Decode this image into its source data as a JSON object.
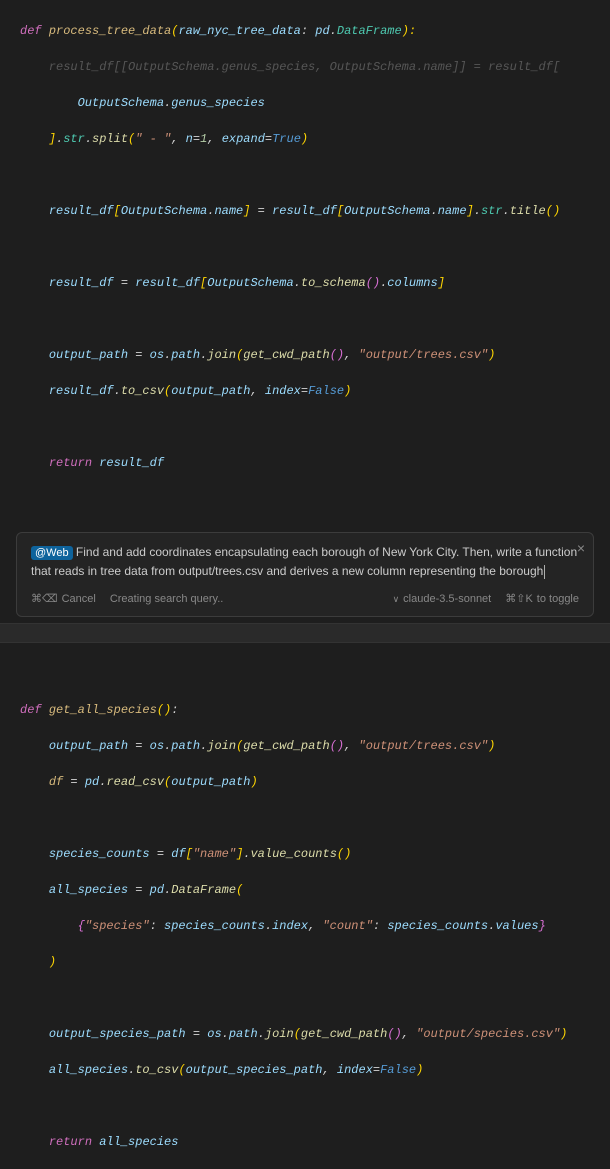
{
  "code1": {
    "def": "def",
    "fn": "process_tree_data",
    "sig_open": "(",
    "param": "raw_nyc_tree_data",
    "colon_sp": ": ",
    "mod": "pd",
    "dot": ".",
    "dftype": "DataFrame",
    "sig_close": "):",
    "faded_line": "    result_df[[OutputSchema.genus_species, OutputSchema.name]] = result_df[",
    "l2a": "        OutputSchema",
    "l2b": "genus_species",
    "l3a": "    ",
    "l3_str": "str",
    "l3_split": "split",
    "l3_sep": "\" - \"",
    "l3_n": "n",
    "l3_nval": "1",
    "l3_expand": "expand",
    "l3_true": "True",
    "l5_rd": "result_df",
    "l5_os": "OutputSchema",
    "l5_name": "name",
    "l5_str": "str",
    "l5_title": "title",
    "l7_rd": "result_df",
    "l7_os": "OutputSchema",
    "l7_ts": "to_schema",
    "l7_cols": "columns",
    "l9_op": "output_path",
    "l9_os": "os",
    "l9_path": "path",
    "l9_join": "join",
    "l9_gcp": "get_cwd_path",
    "l9_str": "\"output/trees.csv\"",
    "l10_rd": "result_df",
    "l10_tc": "to_csv",
    "l10_op": "output_path",
    "l10_idx": "index",
    "l10_false": "False",
    "ret": "return",
    "retv": "result_df"
  },
  "prompt": {
    "mention": "@Web",
    "text": "  Find and add coordinates encapsulating each borough of New York City. Then, write a function that reads in tree data from output/trees.csv and derives a new column representing the borough",
    "cancel_kbd": "⌘⌫",
    "cancel": "Cancel",
    "status": "Creating search query..",
    "model": "claude-3.5-sonnet",
    "toggle_kbd": "⌘⇧K",
    "toggle": "to toggle"
  },
  "code2": {
    "def": "def",
    "fn": "get_all_species",
    "sig": "():",
    "l1_op": "output_path",
    "l1_os": "os",
    "l1_path": "path",
    "l1_join": "join",
    "l1_gcp": "get_cwd_path",
    "l1_str": "\"output/trees.csv\"",
    "l2_df": "df",
    "l2_pd": "pd",
    "l2_rc": "read_csv",
    "l2_op": "output_path",
    "l4_sc": "species_counts",
    "l4_df": "df",
    "l4_key": "\"name\"",
    "l4_vc": "value_counts",
    "l5_as": "all_species",
    "l5_pd": "pd",
    "l5_dftype": "DataFrame",
    "l6_k1": "\"species\"",
    "l6_sc": "species_counts",
    "l6_idx": "index",
    "l6_k2": "\"count\"",
    "l6_vals": "values",
    "l9_osp": "output_species_path",
    "l9_os": "os",
    "l9_path": "path",
    "l9_join": "join",
    "l9_gcp": "get_cwd_path",
    "l9_str": "\"output/species.csv\"",
    "l10_as": "all_species",
    "l10_tc": "to_csv",
    "l10_osp": "output_species_path",
    "l10_idx": "index",
    "l10_false": "False",
    "ret": "return",
    "retv": "all_species"
  }
}
